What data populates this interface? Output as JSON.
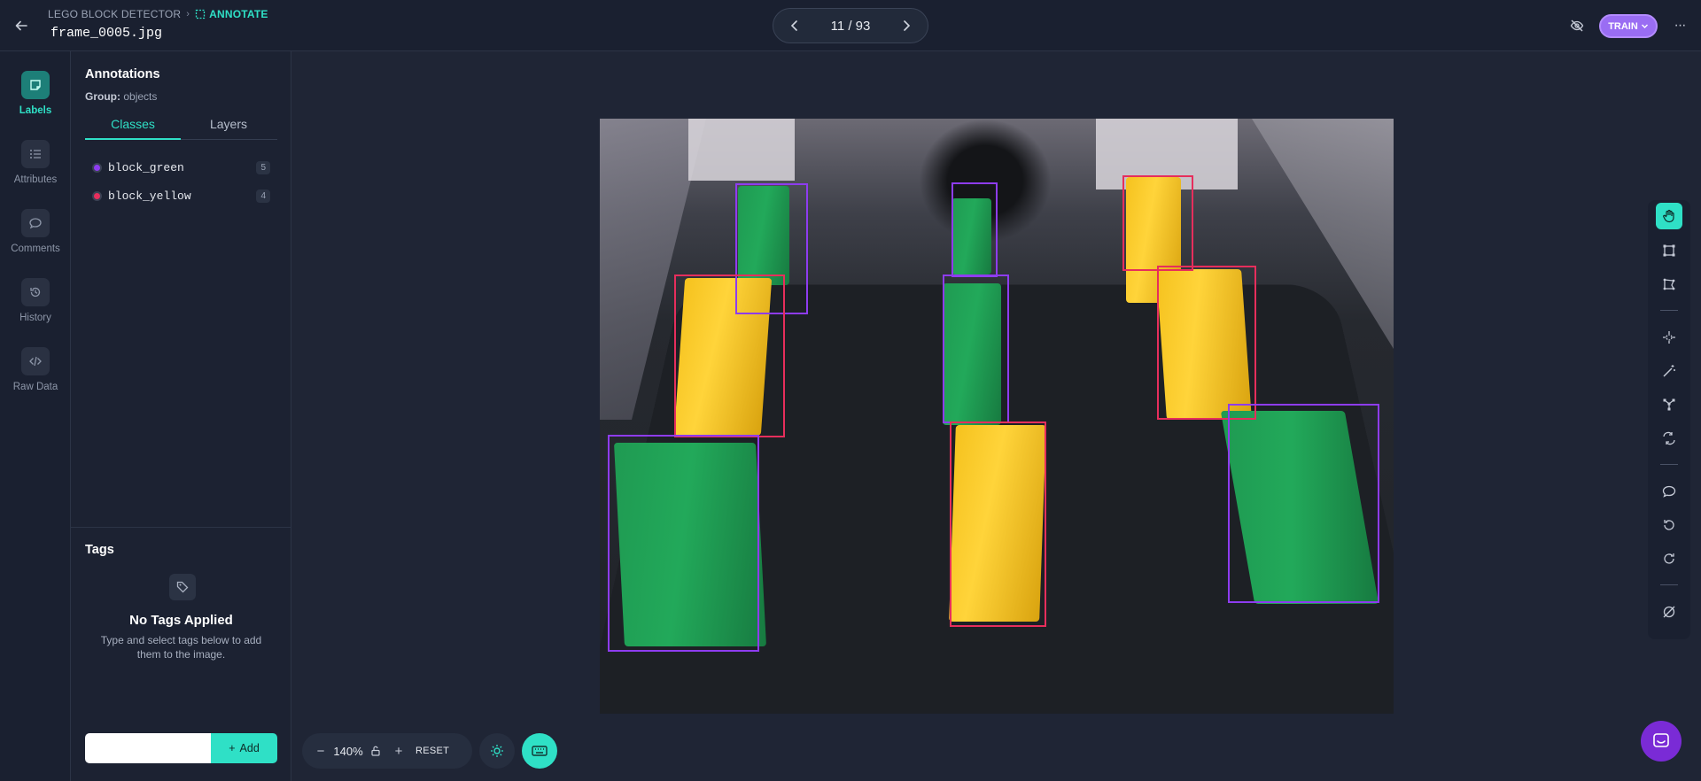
{
  "header": {
    "project": "LEGO BLOCK DETECTOR",
    "mode": "ANNOTATE",
    "filename": "frame_0005.jpg",
    "page_counter": "11 / 93",
    "train_label": "TRAIN",
    "icons": [
      "back-arrow-icon",
      "annotate-icon",
      "chevron-left-icon",
      "chevron-right-icon",
      "eye-off-icon",
      "chevron-down-icon",
      "more-icon"
    ]
  },
  "rail": {
    "items": [
      {
        "label": "Labels",
        "icon": "label-icon",
        "active": true
      },
      {
        "label": "Attributes",
        "icon": "list-icon",
        "active": false
      },
      {
        "label": "Comments",
        "icon": "comment-icon",
        "active": false
      },
      {
        "label": "History",
        "icon": "history-icon",
        "active": false
      },
      {
        "label": "Raw Data",
        "icon": "code-icon",
        "active": false
      }
    ]
  },
  "annotations": {
    "title": "Annotations",
    "group_label": "Group:",
    "group_value": "objects",
    "tabs": [
      "Classes",
      "Layers"
    ],
    "active_tab": "Classes",
    "classes": [
      {
        "name": "block_green",
        "count": "5",
        "color": "#8e3cf0"
      },
      {
        "name": "block_yellow",
        "count": "4",
        "color": "#e62e5c"
      }
    ]
  },
  "tags": {
    "title": "Tags",
    "empty_title": "No Tags Applied",
    "empty_desc": "Type and select tags below to add them to the image.",
    "input_value": "",
    "add_label": "Add"
  },
  "canvas": {
    "zoom": "140%",
    "reset_label": "RESET"
  },
  "colors": {
    "accent": "#2fe0c6",
    "train": "#9a6df3",
    "green_box": "#8e3cf0",
    "yellow_box": "#e62e5c"
  },
  "toolbar": {
    "tools": [
      "pan-hand-icon",
      "bounding-box-icon",
      "polygon-icon",
      "smart-select-icon",
      "magic-wand-icon",
      "keypoint-icon",
      "convert-icon",
      "comment-icon",
      "undo-icon",
      "redo-icon",
      "hide-annotations-icon"
    ]
  }
}
